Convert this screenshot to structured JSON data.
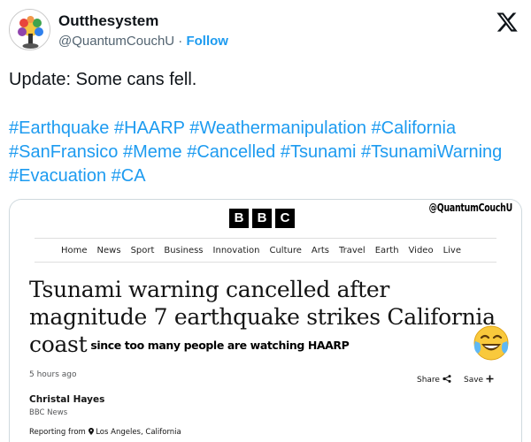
{
  "author": {
    "display_name": "Outthesystem",
    "handle": "@QuantumCouchU",
    "separator": "·",
    "follow_label": "Follow"
  },
  "tweet": {
    "text": "Update: Some cans fell.",
    "hashtags": "#Earthquake #HAARP #Weathermanipulation #California #SanFransico #Meme #Cancelled #Tsunami #TsunamiWarning #Evacuation #CA"
  },
  "media": {
    "watermark": "@QuantumCouchU",
    "logo_letters": [
      "B",
      "B",
      "C"
    ],
    "nav_items": [
      "Home",
      "News",
      "Sport",
      "Business",
      "Innovation",
      "Culture",
      "Arts",
      "Travel",
      "Earth",
      "Video",
      "Live"
    ],
    "headline": "Tsunami warning cancelled after magnitude 7 earthquake strikes California coast",
    "overlay_caption": "since too many people are watching HAARP",
    "time_ago": "5 hours ago",
    "share_label": "Share",
    "save_label": "Save",
    "byline_name": "Christal Hayes",
    "byline_org": "BBC News",
    "reporting_prefix": "Reporting from",
    "reporting_location": "Los Angeles, California"
  },
  "colors": {
    "link_blue": "#1d9bf0",
    "muted_gray": "#536471",
    "text_dark": "#0f1419"
  }
}
